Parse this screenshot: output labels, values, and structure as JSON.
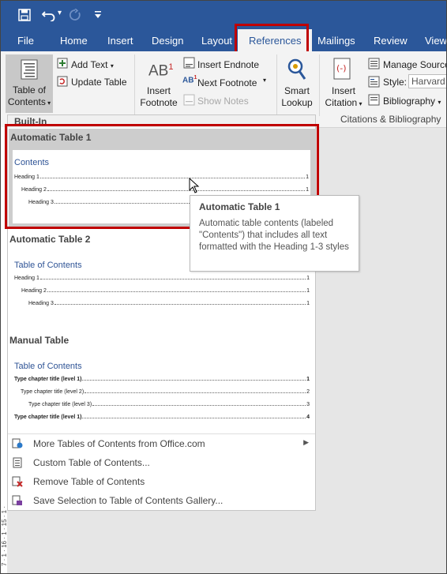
{
  "qat": {
    "save_icon": "save-icon",
    "undo_icon": "undo-icon",
    "undo_dropdown": "▾",
    "redo_icon": "redo-icon",
    "customize_icon": "customize-icon"
  },
  "tabs": [
    "File",
    "Home",
    "Insert",
    "Design",
    "Layout",
    "References",
    "Mailings",
    "Review",
    "View"
  ],
  "active_tab": "References",
  "ribbon": {
    "toc_button": {
      "line1": "Table of",
      "line2": "Contents",
      "icon": "table-of-contents-icon"
    },
    "add_text": "Add Text",
    "update_table": "Update Table",
    "insert_footnote": {
      "line1": "Insert",
      "line2": "Footnote",
      "icon_text": "AB",
      "superscript": "1"
    },
    "insert_endnote": "Insert Endnote",
    "next_footnote": "Next Footnote",
    "show_notes": "Show Notes",
    "smart_lookup": {
      "line1": "Smart",
      "line2": "Lookup"
    },
    "insert_citation": {
      "line1": "Insert",
      "line2": "Citation"
    },
    "manage_sources": "Manage Sources",
    "style_label": "Style:",
    "style_value": "Harvard",
    "bibliography": "Bibliography",
    "group_citations": "Citations & Bibliography"
  },
  "gallery": {
    "section_label": "Built-In",
    "items": [
      {
        "title": "Automatic Table 1",
        "preview_title": "Contents",
        "rows": [
          {
            "label": "Heading 1",
            "page": "1"
          },
          {
            "label": "Heading 2",
            "page": "1"
          },
          {
            "label": "Heading 3",
            "page": "1"
          }
        ]
      },
      {
        "title": "Automatic Table 2",
        "preview_title": "Table of Contents",
        "rows": [
          {
            "label": "Heading 1",
            "page": "1"
          },
          {
            "label": "Heading 2",
            "page": "1"
          },
          {
            "label": "Heading 3",
            "page": "1"
          }
        ]
      },
      {
        "title": "Manual Table",
        "preview_title": "Table of Contents",
        "rows": [
          {
            "label": "Type chapter title (level 1)",
            "page": "1"
          },
          {
            "label": "Type chapter title (level 2)",
            "page": "2"
          },
          {
            "label": "Type chapter title (level 3)",
            "page": "3"
          },
          {
            "label": "Type chapter title (level 1)",
            "page": "4"
          }
        ]
      }
    ],
    "menu": [
      {
        "label": "More Tables of Contents from Office.com",
        "icon": "office-com-icon",
        "has_submenu": true
      },
      {
        "label": "Custom Table of Contents...",
        "icon": "custom-toc-icon",
        "has_submenu": false
      },
      {
        "label": "Remove Table of Contents",
        "icon": "remove-toc-icon",
        "has_submenu": false
      },
      {
        "label": "Save Selection to Table of Contents Gallery...",
        "icon": "save-selection-icon",
        "has_submenu": false
      }
    ]
  },
  "tooltip": {
    "title": "Automatic Table 1",
    "body": "Automatic table contents (labeled \"Contents\") that includes all text formatted with the Heading 1-3 styles"
  },
  "ruler": {
    "numbers": "7 · 1 · 16 · 1 · 15 · 1 ·"
  },
  "colors": {
    "title_bar": "#2b579a",
    "highlight": "#c00000",
    "heading_blue": "#2f5496"
  }
}
